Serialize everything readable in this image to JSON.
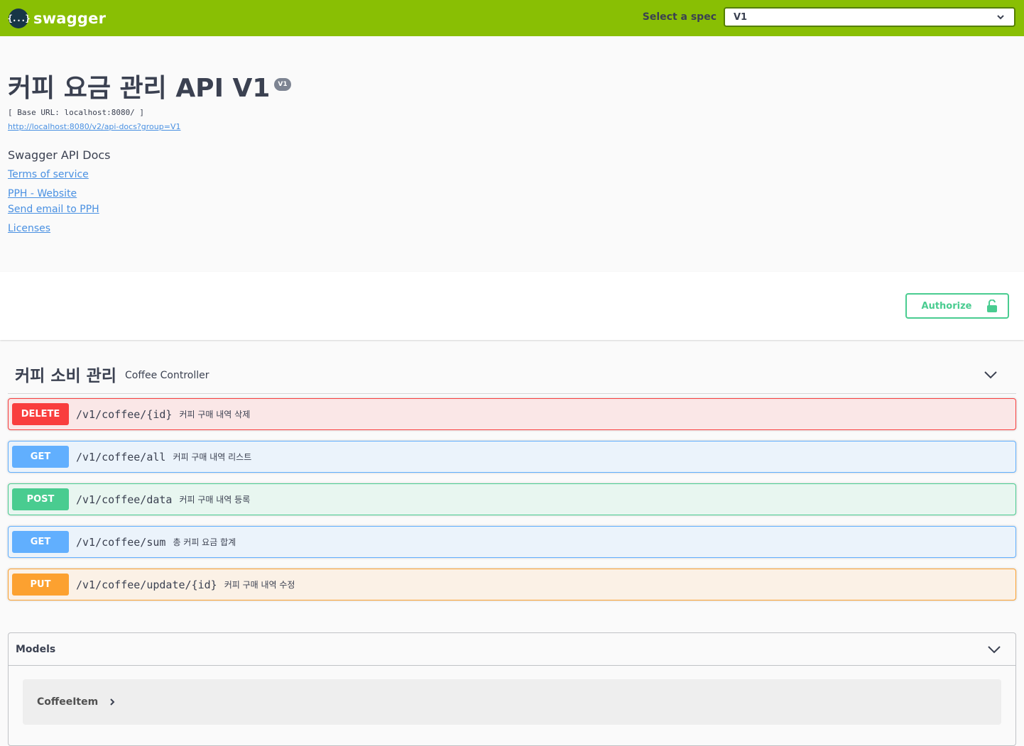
{
  "topbar": {
    "brand": "swagger",
    "logo_glyph": "{...}",
    "spec_label": "Select a spec",
    "spec_value": "V1"
  },
  "info": {
    "title": "커피 요금 관리 API V1",
    "version": "V1",
    "base_url": "[ Base URL: localhost:8080/ ]",
    "docs_url": "http://localhost:8080/v2/api-docs?group=V1",
    "description": "Swagger API Docs",
    "links": {
      "terms": "Terms of service",
      "website": "PPH - Website",
      "email": "Send email to PPH",
      "licenses": "Licenses"
    }
  },
  "auth": {
    "label": "Authorize",
    "icon": "unlock-icon"
  },
  "tag": {
    "name": "커피 소비 관리",
    "description": "Coffee Controller"
  },
  "operations": [
    {
      "method": "DELETE",
      "path": "/v1/coffee/{id}",
      "summary": "커피 구매 내역 삭제",
      "color": "#f93e3e",
      "bg": "#fae7e7"
    },
    {
      "method": "GET",
      "path": "/v1/coffee/all",
      "summary": "커피 구매 내역 리스트",
      "color": "#61affe",
      "bg": "#ebf3fb"
    },
    {
      "method": "POST",
      "path": "/v1/coffee/data",
      "summary": "커피 구매 내역 등록",
      "color": "#49cc90",
      "bg": "#e8f6f0"
    },
    {
      "method": "GET",
      "path": "/v1/coffee/sum",
      "summary": "총 커피 요금 합계",
      "color": "#61affe",
      "bg": "#ebf3fb"
    },
    {
      "method": "PUT",
      "path": "/v1/coffee/update/{id}",
      "summary": "커피 구매 내역 수정",
      "color": "#fca130",
      "bg": "#fbf1e6"
    }
  ],
  "models": {
    "title": "Models",
    "items": [
      {
        "name": "CoffeeItem"
      }
    ]
  }
}
